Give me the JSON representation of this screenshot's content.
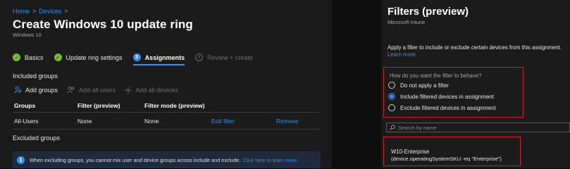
{
  "breadcrumb": {
    "home": "Home",
    "devices": "Devices",
    "sep": ">"
  },
  "page": {
    "title": "Create Windows 10 update ring",
    "more": "···",
    "subtitle": "Windows 10"
  },
  "steps": [
    {
      "num": "✓",
      "label": "Basics",
      "state": "done"
    },
    {
      "num": "✓",
      "label": "Update ring settings",
      "state": "done"
    },
    {
      "num": "3",
      "label": "Assignments",
      "state": "active"
    },
    {
      "num": "4",
      "label": "Review + create",
      "state": "todo"
    }
  ],
  "included": {
    "label": "Included groups",
    "toolbar": {
      "add_groups": "Add groups",
      "add_all_users": "Add all users",
      "add_all_devices": "Add all devices"
    },
    "columns": [
      "Groups",
      "Filter (preview)",
      "Filter mode (preview)",
      "",
      ""
    ],
    "rows": [
      {
        "group": "All-Users",
        "filter": "None",
        "mode": "None",
        "edit": "Edit filter",
        "remove": "Remove"
      }
    ]
  },
  "excluded": {
    "label": "Excluded groups",
    "info": "When excluding groups, you cannot mix user and device groups across include and exclude.",
    "info_link": "Click here to learn more."
  },
  "flyout": {
    "title": "Filters (preview)",
    "subtitle": "Microsoft Intune",
    "description": "Apply a filter to include or exclude certain devices from this assignment.",
    "learn_more": "Learn more",
    "question": "How do you want the filter to behave?",
    "options": [
      {
        "label": "Do not apply a filter",
        "selected": false
      },
      {
        "label": "Include filtered devices in assignment",
        "selected": true
      },
      {
        "label": "Exclude filtered devices in assignment",
        "selected": false
      }
    ],
    "search_placeholder": "Search by name",
    "filter_item": {
      "name": "W10-Enterprise",
      "rule": "(device.operatingSystemSKU -eq \"Enterprise\")"
    }
  },
  "colors": {
    "accent": "#3d8ee6",
    "success": "#7ab83a",
    "highlight_border": "#c8222a",
    "panel": "#1b1b1b"
  }
}
